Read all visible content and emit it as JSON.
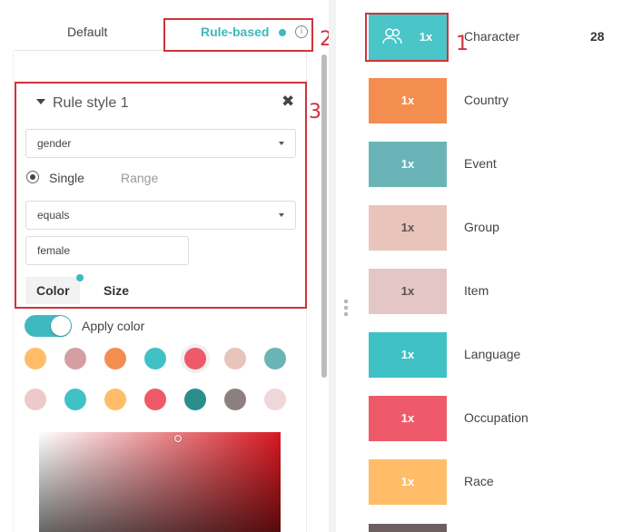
{
  "tabs": {
    "default_label": "Default",
    "rule_based_label": "Rule-based"
  },
  "annotations": [
    "1",
    "2",
    "3"
  ],
  "rule": {
    "title": "Rule style 1",
    "property_value": "gender",
    "mode_single": "Single",
    "mode_range": "Range",
    "operator_value": "equals",
    "input_value": "female",
    "subtab_color": "Color",
    "subtab_size": "Size"
  },
  "apply_color": {
    "label": "Apply color",
    "enabled": true
  },
  "swatches": {
    "row1": [
      "#ffbd6a",
      "#d49ea3",
      "#f48d50",
      "#3fc1c6",
      "#ee5a6a",
      "#e9c4bb",
      "#6ab4b8"
    ],
    "row2": [
      "#ecc9cb",
      "#3fc1c6",
      "#ffbd6a",
      "#ee5a6a",
      "#2a8f8c",
      "#8c7f7f",
      "#efd6d8"
    ],
    "selected": "#ee5a6a"
  },
  "categories": [
    {
      "name": "Character",
      "multiplier": "1x",
      "count": "28",
      "color": "#4ac5c8",
      "icon": "people-icon"
    },
    {
      "name": "Country",
      "multiplier": "1x",
      "count": "",
      "color": "#f48d50",
      "icon": ""
    },
    {
      "name": "Event",
      "multiplier": "1x",
      "count": "",
      "color": "#6ab4b8",
      "icon": ""
    },
    {
      "name": "Group",
      "multiplier": "1x",
      "count": "",
      "color": "#e9c4bb",
      "icon": ""
    },
    {
      "name": "Item",
      "multiplier": "1x",
      "count": "",
      "color": "#e4c6c6",
      "icon": ""
    },
    {
      "name": "Language",
      "multiplier": "1x",
      "count": "",
      "color": "#3fc1c6",
      "icon": ""
    },
    {
      "name": "Occupation",
      "multiplier": "1x",
      "count": "",
      "color": "#ee5a6a",
      "icon": ""
    },
    {
      "name": "Race",
      "multiplier": "1x",
      "count": "",
      "color": "#ffbd6a",
      "icon": ""
    }
  ]
}
